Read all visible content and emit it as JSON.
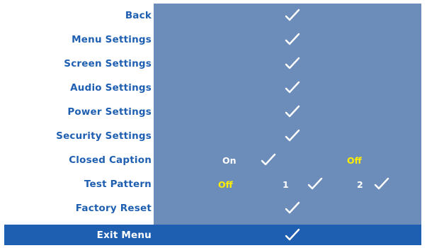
{
  "menu": {
    "items": [
      {
        "label": "Back"
      },
      {
        "label": "Menu Settings"
      },
      {
        "label": "Screen Settings"
      },
      {
        "label": "Audio Settings"
      },
      {
        "label": "Power Settings"
      },
      {
        "label": "Security Settings"
      }
    ],
    "closed_caption": {
      "label": "Closed Caption",
      "on_label": "On",
      "off_label": "Off",
      "selected": "Off"
    },
    "test_pattern": {
      "label": "Test Pattern",
      "off_label": "Off",
      "option1_label": "1",
      "option2_label": "2",
      "selected": "Off"
    },
    "factory_reset": {
      "label": "Factory Reset"
    },
    "exit": {
      "label": "Exit Menu",
      "selected": true
    }
  },
  "colors": {
    "accent": "#1f5fb1",
    "panel": "#6c8db9",
    "highlight_text": "#ffee00",
    "label_text": "#1f5fb1"
  },
  "icons": {
    "check": "checkmark-icon"
  }
}
